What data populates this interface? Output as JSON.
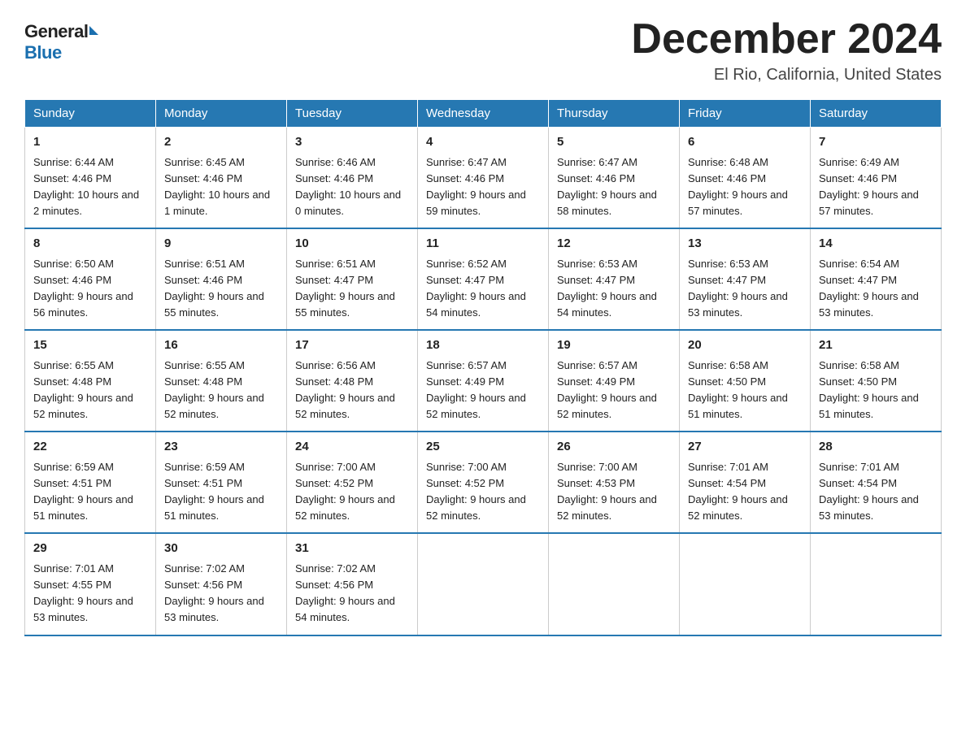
{
  "header": {
    "logo_general": "General",
    "logo_blue": "Blue",
    "title": "December 2024",
    "location": "El Rio, California, United States"
  },
  "days_of_week": [
    "Sunday",
    "Monday",
    "Tuesday",
    "Wednesday",
    "Thursday",
    "Friday",
    "Saturday"
  ],
  "weeks": [
    [
      {
        "day": "1",
        "sunrise": "6:44 AM",
        "sunset": "4:46 PM",
        "daylight": "10 hours and 2 minutes."
      },
      {
        "day": "2",
        "sunrise": "6:45 AM",
        "sunset": "4:46 PM",
        "daylight": "10 hours and 1 minute."
      },
      {
        "day": "3",
        "sunrise": "6:46 AM",
        "sunset": "4:46 PM",
        "daylight": "10 hours and 0 minutes."
      },
      {
        "day": "4",
        "sunrise": "6:47 AM",
        "sunset": "4:46 PM",
        "daylight": "9 hours and 59 minutes."
      },
      {
        "day": "5",
        "sunrise": "6:47 AM",
        "sunset": "4:46 PM",
        "daylight": "9 hours and 58 minutes."
      },
      {
        "day": "6",
        "sunrise": "6:48 AM",
        "sunset": "4:46 PM",
        "daylight": "9 hours and 57 minutes."
      },
      {
        "day": "7",
        "sunrise": "6:49 AM",
        "sunset": "4:46 PM",
        "daylight": "9 hours and 57 minutes."
      }
    ],
    [
      {
        "day": "8",
        "sunrise": "6:50 AM",
        "sunset": "4:46 PM",
        "daylight": "9 hours and 56 minutes."
      },
      {
        "day": "9",
        "sunrise": "6:51 AM",
        "sunset": "4:46 PM",
        "daylight": "9 hours and 55 minutes."
      },
      {
        "day": "10",
        "sunrise": "6:51 AM",
        "sunset": "4:47 PM",
        "daylight": "9 hours and 55 minutes."
      },
      {
        "day": "11",
        "sunrise": "6:52 AM",
        "sunset": "4:47 PM",
        "daylight": "9 hours and 54 minutes."
      },
      {
        "day": "12",
        "sunrise": "6:53 AM",
        "sunset": "4:47 PM",
        "daylight": "9 hours and 54 minutes."
      },
      {
        "day": "13",
        "sunrise": "6:53 AM",
        "sunset": "4:47 PM",
        "daylight": "9 hours and 53 minutes."
      },
      {
        "day": "14",
        "sunrise": "6:54 AM",
        "sunset": "4:47 PM",
        "daylight": "9 hours and 53 minutes."
      }
    ],
    [
      {
        "day": "15",
        "sunrise": "6:55 AM",
        "sunset": "4:48 PM",
        "daylight": "9 hours and 52 minutes."
      },
      {
        "day": "16",
        "sunrise": "6:55 AM",
        "sunset": "4:48 PM",
        "daylight": "9 hours and 52 minutes."
      },
      {
        "day": "17",
        "sunrise": "6:56 AM",
        "sunset": "4:48 PM",
        "daylight": "9 hours and 52 minutes."
      },
      {
        "day": "18",
        "sunrise": "6:57 AM",
        "sunset": "4:49 PM",
        "daylight": "9 hours and 52 minutes."
      },
      {
        "day": "19",
        "sunrise": "6:57 AM",
        "sunset": "4:49 PM",
        "daylight": "9 hours and 52 minutes."
      },
      {
        "day": "20",
        "sunrise": "6:58 AM",
        "sunset": "4:50 PM",
        "daylight": "9 hours and 51 minutes."
      },
      {
        "day": "21",
        "sunrise": "6:58 AM",
        "sunset": "4:50 PM",
        "daylight": "9 hours and 51 minutes."
      }
    ],
    [
      {
        "day": "22",
        "sunrise": "6:59 AM",
        "sunset": "4:51 PM",
        "daylight": "9 hours and 51 minutes."
      },
      {
        "day": "23",
        "sunrise": "6:59 AM",
        "sunset": "4:51 PM",
        "daylight": "9 hours and 51 minutes."
      },
      {
        "day": "24",
        "sunrise": "7:00 AM",
        "sunset": "4:52 PM",
        "daylight": "9 hours and 52 minutes."
      },
      {
        "day": "25",
        "sunrise": "7:00 AM",
        "sunset": "4:52 PM",
        "daylight": "9 hours and 52 minutes."
      },
      {
        "day": "26",
        "sunrise": "7:00 AM",
        "sunset": "4:53 PM",
        "daylight": "9 hours and 52 minutes."
      },
      {
        "day": "27",
        "sunrise": "7:01 AM",
        "sunset": "4:54 PM",
        "daylight": "9 hours and 52 minutes."
      },
      {
        "day": "28",
        "sunrise": "7:01 AM",
        "sunset": "4:54 PM",
        "daylight": "9 hours and 53 minutes."
      }
    ],
    [
      {
        "day": "29",
        "sunrise": "7:01 AM",
        "sunset": "4:55 PM",
        "daylight": "9 hours and 53 minutes."
      },
      {
        "day": "30",
        "sunrise": "7:02 AM",
        "sunset": "4:56 PM",
        "daylight": "9 hours and 53 minutes."
      },
      {
        "day": "31",
        "sunrise": "7:02 AM",
        "sunset": "4:56 PM",
        "daylight": "9 hours and 54 minutes."
      },
      null,
      null,
      null,
      null
    ]
  ],
  "colors": {
    "header_bg": "#2678b2",
    "header_text": "#ffffff",
    "border": "#cccccc",
    "row_border": "#2678b2"
  }
}
